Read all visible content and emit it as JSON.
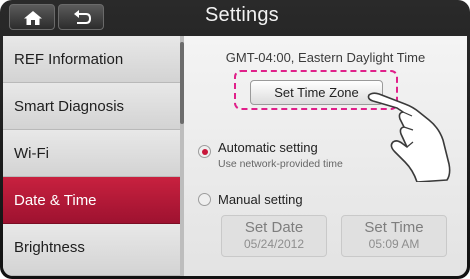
{
  "header": {
    "title": "Settings",
    "home_icon": "home-icon",
    "back_icon": "back-arrow-icon"
  },
  "sidebar": {
    "items": [
      {
        "label": "REF Information"
      },
      {
        "label": "Smart Diagnosis"
      },
      {
        "label": "Wi-Fi"
      },
      {
        "label": "Date & Time",
        "active": true
      },
      {
        "label": "Brightness"
      }
    ]
  },
  "content": {
    "timezone_text": "GMT-04:00, Eastern Daylight Time",
    "set_time_zone_label": "Set Time Zone",
    "automatic": {
      "label": "Automatic setting",
      "sublabel": "Use network-provided time",
      "selected": true
    },
    "manual": {
      "label": "Manual setting",
      "selected": false
    },
    "set_date": {
      "label": "Set Date",
      "value": "05/24/2012"
    },
    "set_time": {
      "label": "Set Time",
      "value": "05:09 AM"
    }
  },
  "colors": {
    "accent": "#b5183a",
    "highlight": "#e0208a"
  }
}
